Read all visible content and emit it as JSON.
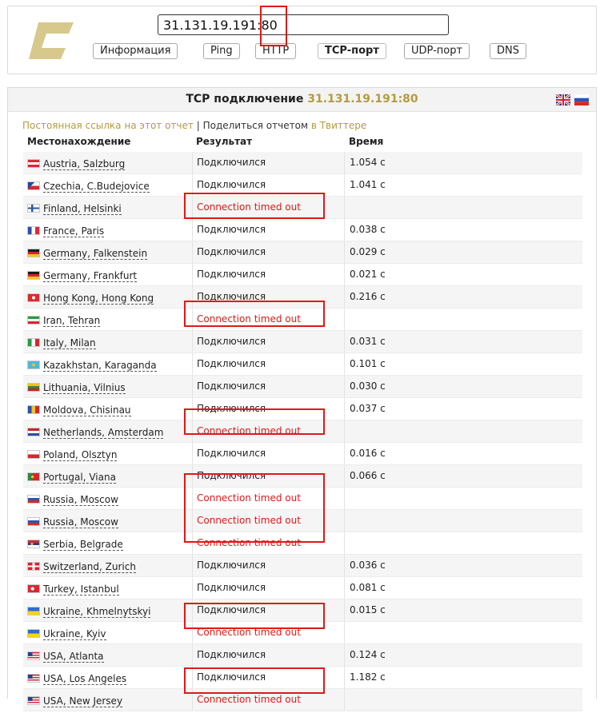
{
  "header": {
    "host_value": "31.131.19.191:80",
    "tabs": [
      {
        "label": "Информация",
        "active": false
      },
      {
        "label": "Ping",
        "active": false
      },
      {
        "label": "HTTP",
        "active": false
      },
      {
        "label": "TCP-порт",
        "active": true
      },
      {
        "label": "UDP-порт",
        "active": false
      },
      {
        "label": "DNS",
        "active": false
      }
    ]
  },
  "panel": {
    "title": "TCP подключение",
    "title_ip": "31.131.19.191:80",
    "permalink_text": "Постоянная ссылка на этот отчет",
    "separator": "|",
    "share_text": "Поделиться отчетом",
    "share_link": "в Твиттере",
    "columns": {
      "location": "Местонахождение",
      "result": "Результат",
      "time": "Время"
    }
  },
  "colors": {
    "accent": "#b39c3c",
    "error": "#e01818"
  },
  "rows": [
    {
      "flag": "austria-flag",
      "location": "Austria, Salzburg",
      "result": "Подключился",
      "time": "1.054 с",
      "timeout": false
    },
    {
      "flag": "czechia-flag",
      "location": "Czechia, C.Budejovice",
      "result": "Подключился",
      "time": "1.041 с",
      "timeout": false
    },
    {
      "flag": "finland-flag",
      "location": "Finland, Helsinki",
      "result": "Connection timed out",
      "time": "",
      "timeout": true
    },
    {
      "flag": "france-flag",
      "location": "France, Paris",
      "result": "Подключился",
      "time": "0.038 с",
      "timeout": false
    },
    {
      "flag": "germany-flag",
      "location": "Germany, Falkenstein",
      "result": "Подключился",
      "time": "0.029 с",
      "timeout": false
    },
    {
      "flag": "germany-flag",
      "location": "Germany, Frankfurt",
      "result": "Подключился",
      "time": "0.021 с",
      "timeout": false
    },
    {
      "flag": "hongkong-flag",
      "location": "Hong Kong, Hong Kong",
      "result": "Подключился",
      "time": "0.216 с",
      "timeout": false
    },
    {
      "flag": "iran-flag",
      "location": "Iran, Tehran",
      "result": "Connection timed out",
      "time": "",
      "timeout": true
    },
    {
      "flag": "italy-flag",
      "location": "Italy, Milan",
      "result": "Подключился",
      "time": "0.031 с",
      "timeout": false
    },
    {
      "flag": "kazakhstan-flag",
      "location": "Kazakhstan, Karaganda",
      "result": "Подключился",
      "time": "0.101 с",
      "timeout": false
    },
    {
      "flag": "lithuania-flag",
      "location": "Lithuania, Vilnius",
      "result": "Подключился",
      "time": "0.030 с",
      "timeout": false
    },
    {
      "flag": "moldova-flag",
      "location": "Moldova, Chisinau",
      "result": "Подключился",
      "time": "0.037 с",
      "timeout": false
    },
    {
      "flag": "netherlands-flag",
      "location": "Netherlands, Amsterdam",
      "result": "Connection timed out",
      "time": "",
      "timeout": true
    },
    {
      "flag": "poland-flag",
      "location": "Poland, Olsztyn",
      "result": "Подключился",
      "time": "0.016 с",
      "timeout": false
    },
    {
      "flag": "portugal-flag",
      "location": "Portugal, Viana",
      "result": "Подключился",
      "time": "0.066 с",
      "timeout": false
    },
    {
      "flag": "russia-flag",
      "location": "Russia, Moscow",
      "result": "Connection timed out",
      "time": "",
      "timeout": true
    },
    {
      "flag": "russia-flag",
      "location": "Russia, Moscow",
      "result": "Connection timed out",
      "time": "",
      "timeout": true
    },
    {
      "flag": "serbia-flag",
      "location": "Serbia, Belgrade",
      "result": "Connection timed out",
      "time": "",
      "timeout": true
    },
    {
      "flag": "switzerland-flag",
      "location": "Switzerland, Zurich",
      "result": "Подключился",
      "time": "0.036 с",
      "timeout": false
    },
    {
      "flag": "turkey-flag",
      "location": "Turkey, Istanbul",
      "result": "Подключился",
      "time": "0.081 с",
      "timeout": false
    },
    {
      "flag": "ukraine-flag",
      "location": "Ukraine, Khmelnytskyi",
      "result": "Подключился",
      "time": "0.015 с",
      "timeout": false
    },
    {
      "flag": "ukraine-flag",
      "location": "Ukraine, Kyiv",
      "result": "Connection timed out",
      "time": "",
      "timeout": true
    },
    {
      "flag": "usa-flag",
      "location": "USA, Atlanta",
      "result": "Подключился",
      "time": "0.124 с",
      "timeout": false
    },
    {
      "flag": "usa-flag",
      "location": "USA, Los Angeles",
      "result": "Подключился",
      "time": "1.182 с",
      "timeout": false
    },
    {
      "flag": "usa-flag",
      "location": "USA, New Jersey",
      "result": "Connection timed out",
      "time": "",
      "timeout": true
    }
  ]
}
